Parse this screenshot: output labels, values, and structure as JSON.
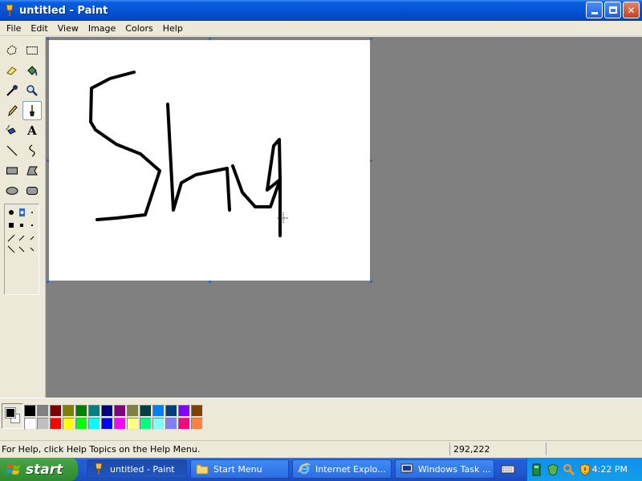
{
  "window": {
    "title": "untitled - Paint"
  },
  "menu": {
    "items": [
      "File",
      "Edit",
      "View",
      "Image",
      "Colors",
      "Help"
    ]
  },
  "tools": [
    "free-form-select",
    "select",
    "eraser",
    "fill",
    "pick-color",
    "magnifier",
    "pencil",
    "brush",
    "airbrush",
    "text",
    "line",
    "curve",
    "rectangle",
    "polygon",
    "ellipse",
    "rounded-rectangle"
  ],
  "active_tool": "brush",
  "canvas": {
    "background": "#ffffff",
    "stroke_color": "#000000"
  },
  "palette": {
    "foreground": "#000000",
    "background": "#ffffff",
    "row1": [
      "#000000",
      "#808080",
      "#800000",
      "#808000",
      "#008000",
      "#008080",
      "#000080",
      "#800080",
      "#808040",
      "#004040",
      "#0080ff",
      "#004080",
      "#8000ff",
      "#804000"
    ],
    "row2": [
      "#ffffff",
      "#c0c0c0",
      "#ff0000",
      "#ffff00",
      "#00ff00",
      "#00ffff",
      "#0000ff",
      "#ff00ff",
      "#ffff80",
      "#00ff80",
      "#80ffff",
      "#8080ff",
      "#ff0080",
      "#ff8040"
    ]
  },
  "status": {
    "help": "For Help, click Help Topics on the Help Menu.",
    "coords": "292,222"
  },
  "taskbar": {
    "start_label": "start",
    "tasks": [
      {
        "label": "untitled - Paint",
        "active": true
      },
      {
        "label": "Start Menu",
        "active": false
      },
      {
        "label": "Internet Explo...",
        "active": false
      },
      {
        "label": "Windows Task ...",
        "active": false
      }
    ],
    "clock": "4:22 PM"
  }
}
